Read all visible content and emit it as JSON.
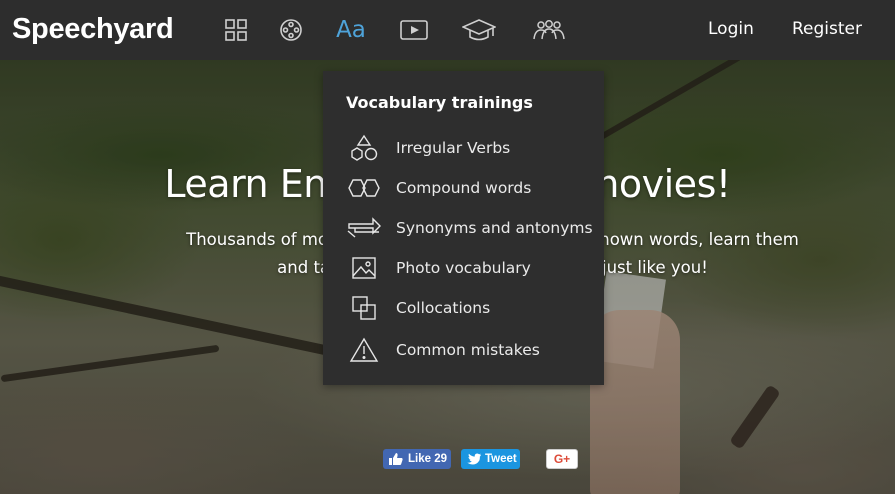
{
  "brand": {
    "logo": "Speechyard"
  },
  "nav": {
    "icons": [
      {
        "name": "grid-icon"
      },
      {
        "name": "film-reel-icon"
      },
      {
        "name": "vocabulary-aa-icon",
        "text": "Aa",
        "active": true
      },
      {
        "name": "play-video-icon"
      },
      {
        "name": "graduation-cap-icon"
      },
      {
        "name": "community-icon"
      }
    ],
    "login": "Login",
    "register": "Register"
  },
  "dropdown": {
    "title": "Vocabulary trainings",
    "items": [
      {
        "label": "Irregular Verbs",
        "icon": "shapes-icon"
      },
      {
        "label": "Compound words",
        "icon": "hexagons-icon"
      },
      {
        "label": "Synonyms and antonyms",
        "icon": "arrows-exchange-icon"
      },
      {
        "label": "Photo vocabulary",
        "icon": "photo-icon"
      },
      {
        "label": "Collocations",
        "icon": "overlapping-squares-icon"
      },
      {
        "label": "Common mistakes",
        "icon": "warning-icon"
      }
    ]
  },
  "hero": {
    "title": "Learn English through movies!",
    "subtitle": "Thousands of movies and TV series. Translate unknown words, learn them and talk with people who learn English just like you!"
  },
  "social": {
    "facebook": "Like 29",
    "twitter": "Tweet",
    "google": "G+"
  },
  "colors": {
    "navbar": "#2d2d2d",
    "dropdown": "#2e2e2e",
    "active_icon": "#4ea3d9",
    "facebook": "#4267b2",
    "twitter": "#1b95e0"
  }
}
